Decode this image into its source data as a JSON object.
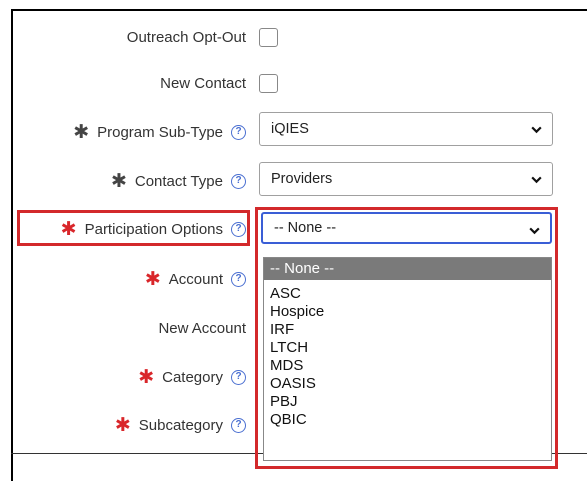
{
  "form": {
    "outreach_opt_out_label": "Outreach Opt-Out",
    "new_contact_label": "New Contact",
    "program_sub_type_label": "Program Sub-Type",
    "program_sub_type_value": "iQIES",
    "contact_type_label": "Contact Type",
    "contact_type_value": "Providers",
    "participation_options_label": "Participation Options",
    "participation_options_value": "-- None --",
    "account_label": "Account",
    "new_account_label": "New Account",
    "category_label": "Category",
    "subcategory_label": "Subcategory"
  },
  "dropdown": {
    "options": [
      "-- None --",
      "ASC",
      "Hospice",
      "IRF",
      "LTCH",
      "MDS",
      "OASIS",
      "PBJ",
      "QBIC"
    ]
  },
  "icons": {
    "required": "asterisk-icon",
    "help": "help-circle-icon",
    "chevron": "chevron-down-icon"
  },
  "colors": {
    "required_red": "#d9262a",
    "highlight_red": "#d3292b",
    "focus_blue": "#3a5ed6",
    "selected_option_bg": "#7a7a7a"
  }
}
